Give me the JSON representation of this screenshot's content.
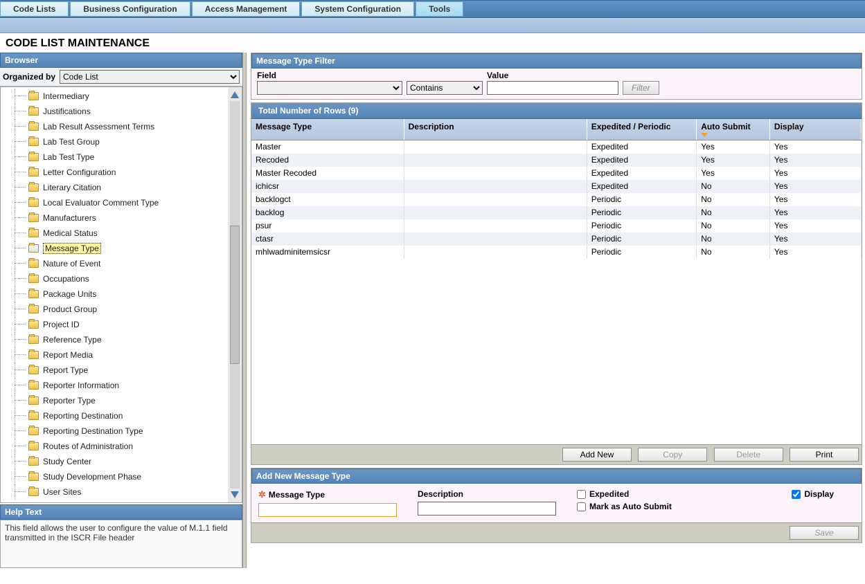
{
  "nav": {
    "items": [
      "Code Lists",
      "Business Configuration",
      "Access Management",
      "System Configuration",
      "Tools"
    ],
    "active_index": 4
  },
  "page_title": "CODE LIST MAINTENANCE",
  "browser": {
    "header": "Browser",
    "organized_label": "Organized by",
    "organized_value": "Code List",
    "items": [
      {
        "label": "Intermediary"
      },
      {
        "label": "Justifications"
      },
      {
        "label": "Lab Result Assessment Terms"
      },
      {
        "label": "Lab Test Group"
      },
      {
        "label": "Lab Test Type"
      },
      {
        "label": "Letter Configuration"
      },
      {
        "label": "Literary Citation"
      },
      {
        "label": "Local Evaluator Comment Type"
      },
      {
        "label": "Manufacturers"
      },
      {
        "label": "Medical Status"
      },
      {
        "label": "Message Type",
        "selected": true
      },
      {
        "label": "Nature of Event"
      },
      {
        "label": "Occupations"
      },
      {
        "label": "Package Units"
      },
      {
        "label": "Product Group"
      },
      {
        "label": "Project ID"
      },
      {
        "label": "Reference Type"
      },
      {
        "label": "Report Media"
      },
      {
        "label": "Report Type"
      },
      {
        "label": "Reporter Information"
      },
      {
        "label": "Reporter Type"
      },
      {
        "label": "Reporting Destination"
      },
      {
        "label": "Reporting Destination Type"
      },
      {
        "label": "Routes of Administration"
      },
      {
        "label": "Study Center"
      },
      {
        "label": "Study Development Phase"
      },
      {
        "label": "User Sites"
      }
    ]
  },
  "help": {
    "header": "Help Text",
    "body": "This field allows the user to configure the value of M.1.1 field transmitted in the ISCR File header"
  },
  "filter": {
    "header": "Message Type Filter",
    "field_label": "Field",
    "contains_label": "Contains",
    "value_label": "Value",
    "filter_btn": "Filter"
  },
  "rows": {
    "header": "Total Number of Rows (9)",
    "columns": [
      "Message Type",
      "Description",
      "Expedited / Periodic",
      "Auto Submit",
      "Display"
    ],
    "data": [
      {
        "mt": "Master",
        "desc": "",
        "ep": "Expedited",
        "as": "Yes",
        "dp": "Yes"
      },
      {
        "mt": "Recoded",
        "desc": "",
        "ep": "Expedited",
        "as": "Yes",
        "dp": "Yes"
      },
      {
        "mt": "Master Recoded",
        "desc": "",
        "ep": "Expedited",
        "as": "Yes",
        "dp": "Yes"
      },
      {
        "mt": "ichicsr",
        "desc": "",
        "ep": "Expedited",
        "as": "No",
        "dp": "Yes"
      },
      {
        "mt": "backlogct",
        "desc": "",
        "ep": "Periodic",
        "as": "No",
        "dp": "Yes"
      },
      {
        "mt": "backlog",
        "desc": "",
        "ep": "Periodic",
        "as": "No",
        "dp": "Yes"
      },
      {
        "mt": "psur",
        "desc": "",
        "ep": "Periodic",
        "as": "No",
        "dp": "Yes"
      },
      {
        "mt": "ctasr",
        "desc": "",
        "ep": "Periodic",
        "as": "No",
        "dp": "Yes"
      },
      {
        "mt": "mhlwadminitemsicsr",
        "desc": "",
        "ep": "Periodic",
        "as": "No",
        "dp": "Yes"
      }
    ]
  },
  "actions": {
    "add": "Add New",
    "copy": "Copy",
    "delete": "Delete",
    "print": "Print"
  },
  "addnew": {
    "header": "Add New Message Type",
    "message_type_label": "Message Type",
    "description_label": "Description",
    "expedited_label": "Expedited",
    "mark_label": "Mark as Auto Submit",
    "display_label": "Display",
    "save": "Save"
  }
}
